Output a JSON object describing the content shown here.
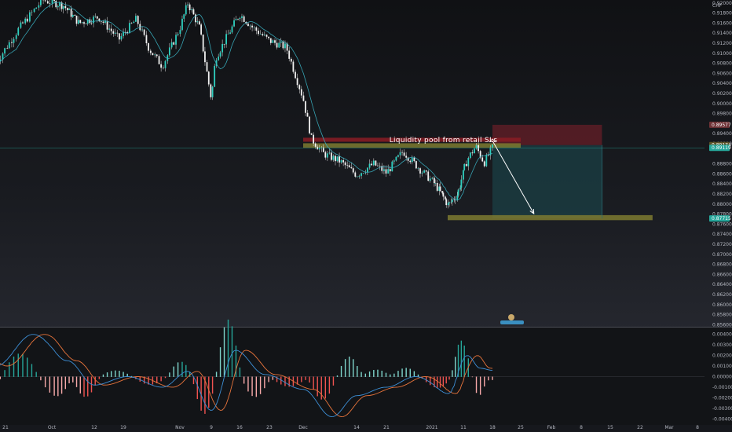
{
  "chart_data": {
    "type": "candlestick",
    "currency": "CHF",
    "price_axis": {
      "ticks": [
        "0.92000",
        "0.91800",
        "0.91600",
        "0.91400",
        "0.91200",
        "0.91000",
        "0.90800",
        "0.90600",
        "0.90400",
        "0.90200",
        "0.90000",
        "0.89800",
        "0.89400",
        "0.89200",
        "0.88800",
        "0.88600",
        "0.88400",
        "0.88200",
        "0.88000",
        "0.87800",
        "0.87600",
        "0.87400",
        "0.87200",
        "0.87000",
        "0.86800",
        "0.86600",
        "0.86400",
        "0.86200",
        "0.86000",
        "0.85800",
        "0.85600"
      ],
      "range": [
        0.8556,
        0.9206
      ]
    },
    "price_tags": [
      {
        "label": "0.89577",
        "value": 0.89577,
        "color": "#6e3236"
      },
      {
        "label": "0.89174",
        "value": 0.89174,
        "color": "#5a5228"
      },
      {
        "label": "0.89119",
        "value": 0.89119,
        "color": "#26a69a"
      },
      {
        "label": "0.87715",
        "value": 0.87715,
        "color": "#26a69a"
      }
    ],
    "current_price": 0.89119,
    "macd_axis": {
      "ticks": [
        "0.00400",
        "0.00300",
        "0.00200",
        "0.00100",
        "0.00000",
        "-0.00100",
        "-0.00200",
        "-0.00300",
        "-0.00400"
      ],
      "range": [
        -0.0042,
        0.0042
      ]
    },
    "time_axis": [
      "21",
      "Oct",
      "12",
      "19",
      "Nov",
      "9",
      "16",
      "23",
      "Dec",
      "14",
      "21",
      "2021",
      "11",
      "18",
      "25",
      "Feb",
      "8",
      "15",
      "22",
      "Mar",
      "8"
    ],
    "annotation": "Liquidity pool from retail SLs",
    "zones": [
      {
        "name": "liquidity-pool",
        "color": "#8b1c24",
        "y": [
          0.8924,
          0.8932
        ],
        "x": [
          "2020-12-01",
          "2021-01-25"
        ]
      },
      {
        "name": "supply-zone",
        "color": "#7d7a30",
        "y": [
          0.8912,
          0.8921
        ],
        "x": [
          "2020-12-01",
          "2021-01-25"
        ]
      },
      {
        "name": "demand-zone",
        "color": "#7d7a30",
        "y": [
          0.8768,
          0.8778
        ],
        "x": [
          "2021-01-06",
          "2021-02-25"
        ]
      },
      {
        "name": "stop-zone",
        "color": "#7a1f2a",
        "y": [
          0.89174,
          0.89577
        ],
        "x": [
          "2021-01-18",
          "2021-02-13"
        ]
      },
      {
        "name": "target-zone",
        "color": "#1c4c52",
        "y": [
          0.87715,
          0.89174
        ],
        "x": [
          "2021-01-18",
          "2021-02-13"
        ]
      }
    ],
    "projection_arrow": {
      "from": [
        "2021-01-18",
        0.8926
      ],
      "to": [
        "2021-01-28",
        0.8781
      ]
    }
  }
}
